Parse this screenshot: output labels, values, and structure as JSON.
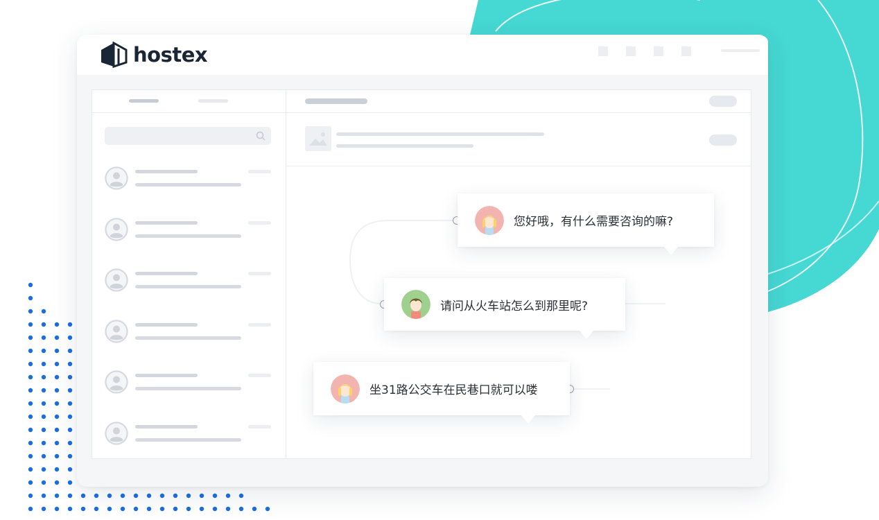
{
  "brand": {
    "name": "hostex",
    "accent_color": "#3fd6d0",
    "logo_color": "#1a2636",
    "dots_color": "#1a6ee0"
  },
  "header": {
    "icons": [
      "window-control-icon",
      "window-control-icon",
      "window-control-icon",
      "window-control-icon"
    ]
  },
  "messages": [
    {
      "text": "您好哦，有什么需要咨询的嘛?",
      "sender": "host",
      "avatar": "girl-avatar-icon"
    },
    {
      "text": "请问从火车站怎么到那里呢?",
      "sender": "guest",
      "avatar": "boy-avatar-icon"
    },
    {
      "text": "坐31路公交车在民巷口就可以喽",
      "sender": "host",
      "avatar": "girl-avatar-icon"
    }
  ]
}
